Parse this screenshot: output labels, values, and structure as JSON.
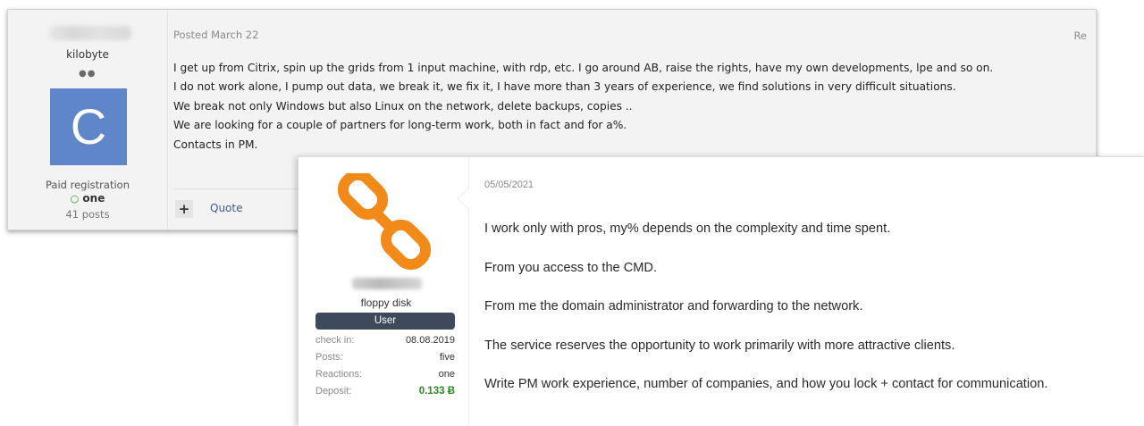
{
  "post1": {
    "username_blurred": "",
    "user_title": "kilobyte",
    "rank_dots": "●●",
    "avatar_letter": "C",
    "avatar_color": "#5f86c9",
    "registration": "Paid registration",
    "online_status": "one",
    "online_icon": "online-status-icon",
    "posts_count": "41 posts",
    "date": "Posted March 22",
    "reply_label": "Re",
    "body_lines": [
      "I get up from Citrix, spin up the grids from 1 input machine, with rdp, etc. I go around AB, raise the rights, have my own developments, lpe and so on.",
      "I do not work alone, I pump out data, we break it, we fix it, I have more than 3 years of experience, we find solutions in very difficult situations.",
      "We break not only Windows but also Linux on the network, delete backups, copies ..",
      "We are looking for a couple of partners for long-term work, both in fact and for a%.",
      "Contacts in PM."
    ],
    "plus_label": "+",
    "quote_label": "Quote"
  },
  "post2": {
    "avatar_icon": "chain-link-icon",
    "avatar_color": "#f28a1a",
    "username_blurred": "",
    "user_title": "floppy disk",
    "role": "User",
    "role_color": "#3e4a5c",
    "stats": [
      {
        "label": "check in:",
        "value": "08.08.2019"
      },
      {
        "label": "Posts:",
        "value": "five"
      },
      {
        "label": "Reactions:",
        "value": "one"
      },
      {
        "label": "Deposit:",
        "value": "0.133 Ƀ"
      }
    ],
    "deposit_color": "#2e8b24",
    "date": "05/05/2021",
    "paragraphs": [
      "I work only with pros, my% depends on the complexity and time spent.",
      "From you access to the CMD.",
      "From me the domain administrator and forwarding to the network.",
      "The service reserves the opportunity to work primarily with more attractive clients.",
      "Write PM work experience, number of companies, and how you lock + contact for communication."
    ]
  }
}
